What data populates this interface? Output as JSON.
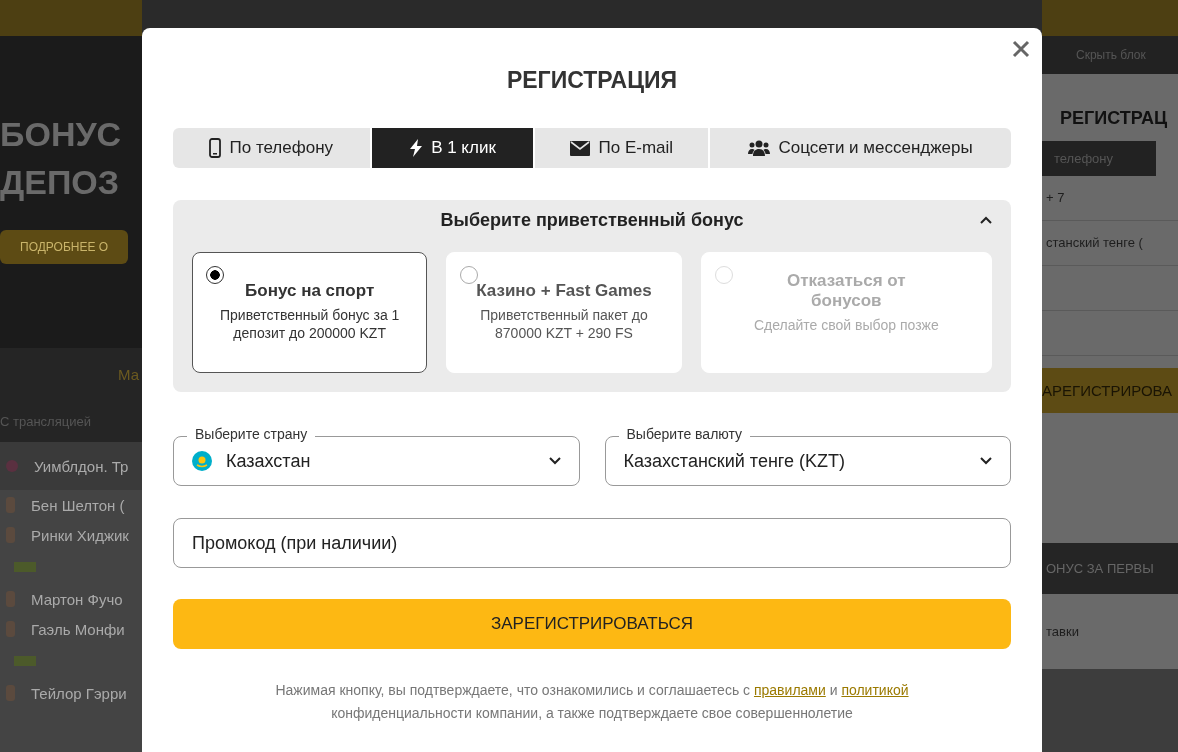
{
  "background": {
    "left": {
      "hero_title": [
        "БОНУС",
        "ДЕПОЗ"
      ],
      "hero_button": "ПОДРОБНЕЕ О",
      "tab": "Ма",
      "filter": "С трансляцией",
      "league": "Уимблдон. Тр",
      "players": [
        "Бен Шелтон (",
        "Ринки Хиджик",
        "Мартон Фучо",
        "Гаэль Монфи",
        "Тейлор Гэрри"
      ]
    },
    "right": {
      "hide_link": "Скрыть блок",
      "title": "РЕГИСТРАЦ",
      "tab": "телефону",
      "phone": "+ 7",
      "currency": "станский тенге (",
      "register": "АРЕГИСТРИРОВА",
      "bonus": "ОНУС ЗА ПЕРВЫ",
      "bets": "тавки"
    }
  },
  "modal": {
    "title": "РЕГИСТРАЦИЯ",
    "tabs": [
      {
        "kind": "phone",
        "label": "По телефону",
        "selected": false
      },
      {
        "kind": "oneclick",
        "label": "В 1 клик",
        "selected": true
      },
      {
        "kind": "email",
        "label": "По E-mail",
        "selected": false
      },
      {
        "kind": "social",
        "label": "Соцсети и мессенджеры",
        "selected": false
      }
    ],
    "bonus": {
      "title": "Выберите приветственный бонус",
      "expanded": true,
      "options": [
        {
          "title": "Бонус на спорт",
          "description": "Приветственный бонус за 1 депозит до 200000 KZT",
          "selected": true,
          "disabled": false
        },
        {
          "title": "Казино + Fast Games",
          "description": "Приветственный пакет до 870000 KZT + 290 FS",
          "selected": false,
          "disabled": false
        },
        {
          "title": "Отказаться от бонусов",
          "description": "Сделайте свой выбор позже",
          "selected": false,
          "disabled": true
        }
      ]
    },
    "country": {
      "label": "Выберите страну",
      "value": "Казахстан"
    },
    "currency": {
      "label": "Выберите валюту",
      "value": "Казахстанский тенге (KZT)"
    },
    "promo": {
      "placeholder": "Промокод (при наличии)"
    },
    "submit": "ЗАРЕГИСТРИРОВАТЬСЯ",
    "legal": {
      "before": "Нажимая кнопку, вы подтверждаете, что ознакомились и соглашаетесь с",
      "link1": "правилами",
      "middle": "и",
      "link2": "политикой",
      "after": "конфиденциальности компании, а также подтверждаете свое совершеннолетие"
    }
  }
}
